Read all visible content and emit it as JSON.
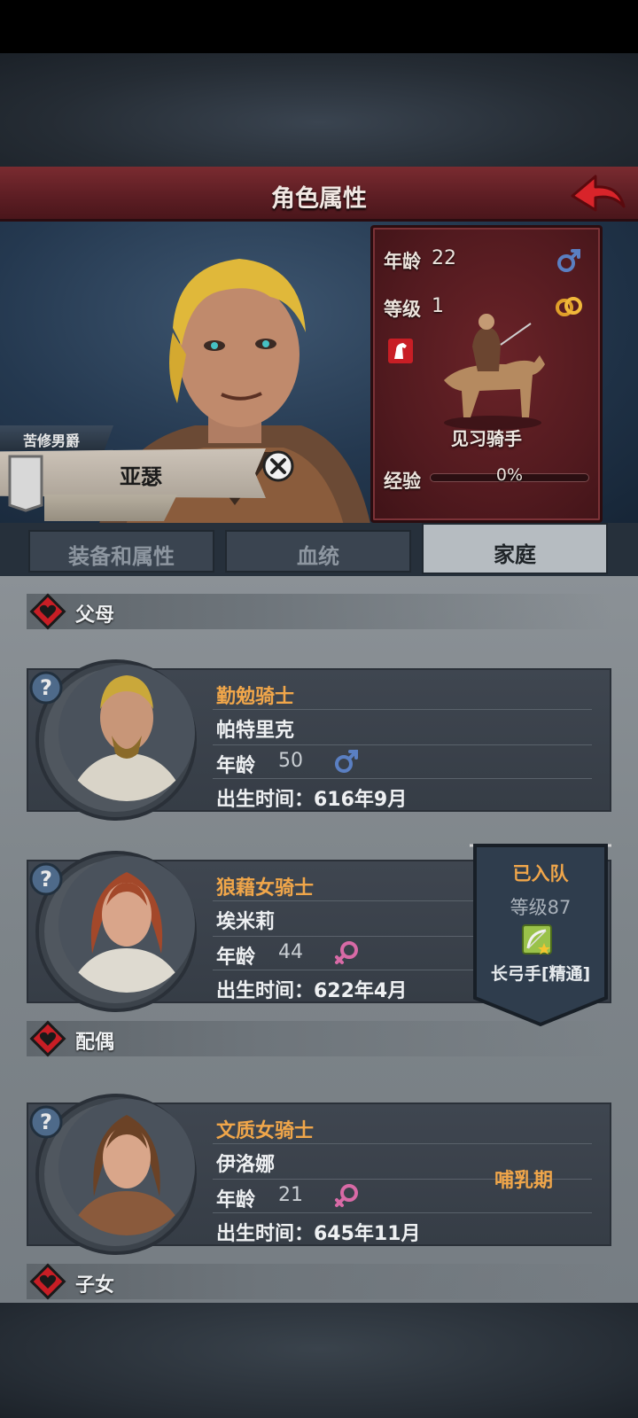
{
  "header": {
    "title": "角色属性"
  },
  "hero": {
    "title_tag": "苦修男爵",
    "name": "亚瑟"
  },
  "stats": {
    "age_label": "年龄",
    "age": "22",
    "level_label": "等级",
    "level": "1",
    "class_name": "见习骑手",
    "exp_label": "经验",
    "exp_value": "0%",
    "exp_progress": 0
  },
  "tabs": [
    {
      "label": "装备和属性",
      "active": false
    },
    {
      "label": "血统",
      "active": false
    },
    {
      "label": "家庭",
      "active": true
    }
  ],
  "family": {
    "parents_label": "父母",
    "spouse_label": "配偶",
    "children_label": "子女",
    "age_label": "年龄",
    "members": [
      {
        "title": "勤勉骑士",
        "name": "帕特里克",
        "age": "50",
        "gender": "male",
        "birth": "出生时间：616年9月"
      },
      {
        "title": "狼藉女骑士",
        "name": "埃米莉",
        "age": "44",
        "gender": "female",
        "birth": "出生时间：622年4月"
      },
      {
        "title": "文质女骑士",
        "name": "伊洛娜",
        "age": "21",
        "gender": "female",
        "birth": "出生时间：645年11月",
        "status": "哺乳期"
      }
    ],
    "party_badge": {
      "status": "已入队",
      "level": "等级87",
      "class": "长弓手[精通]"
    }
  },
  "colors": {
    "accent_orange": "#f0a64a",
    "title_bar": "#6b242a",
    "male_blue": "#5a7fc2",
    "female_pink": "#d86aa6"
  }
}
